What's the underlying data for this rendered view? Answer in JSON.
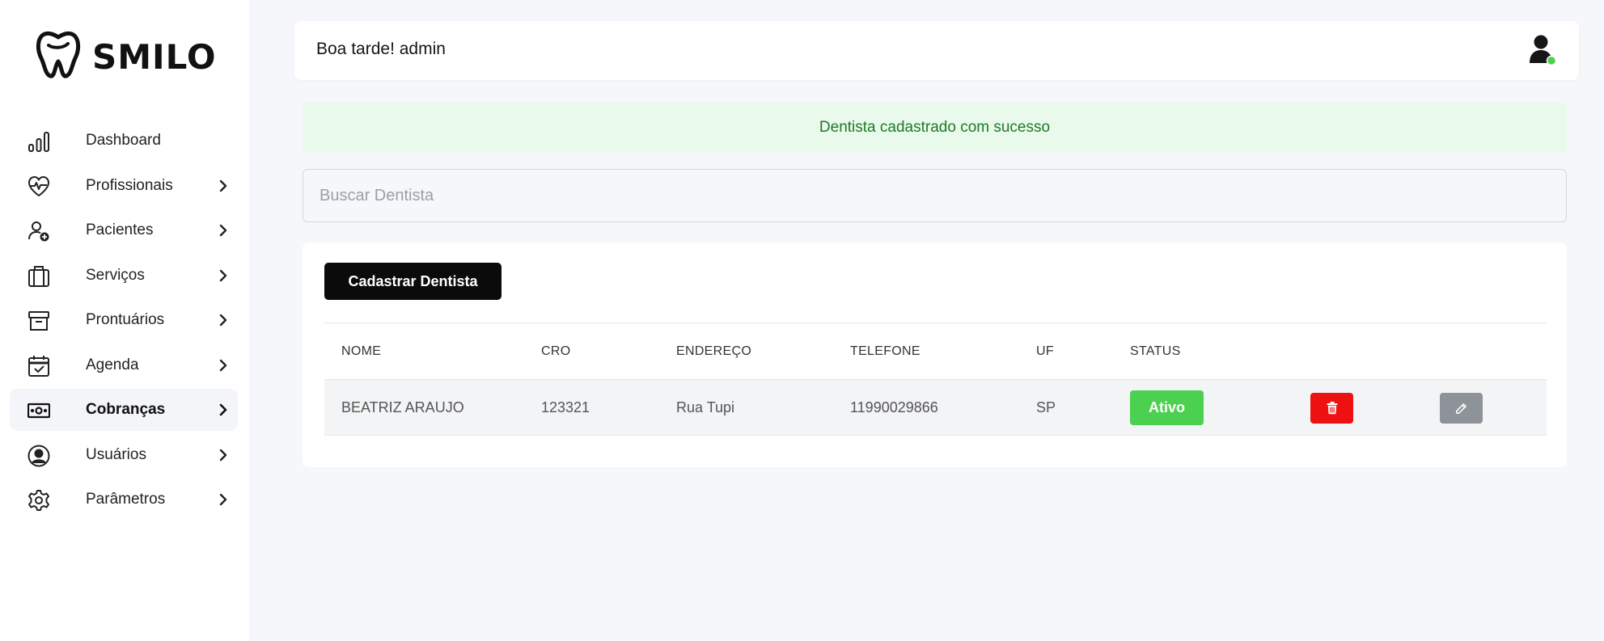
{
  "brand": {
    "name": "SMILO",
    "logo_icon": "tooth-icon"
  },
  "sidebar": {
    "items": [
      {
        "label": "Dashboard",
        "icon": "bar-chart-icon",
        "has_submenu": false
      },
      {
        "label": "Profissionais",
        "icon": "heart-pulse-icon",
        "has_submenu": true
      },
      {
        "label": "Pacientes",
        "icon": "user-plus-icon",
        "has_submenu": true
      },
      {
        "label": "Serviços",
        "icon": "briefcase-icon",
        "has_submenu": true
      },
      {
        "label": "Prontuários",
        "icon": "archive-icon",
        "has_submenu": true
      },
      {
        "label": "Agenda",
        "icon": "calendar-check-icon",
        "has_submenu": true
      },
      {
        "label": "Cobranças",
        "icon": "money-icon",
        "has_submenu": true,
        "active": true
      },
      {
        "label": "Usuários",
        "icon": "user-circle-icon",
        "has_submenu": true
      },
      {
        "label": "Parâmetros",
        "icon": "gear-icon",
        "has_submenu": true
      }
    ]
  },
  "header": {
    "greeting": "Boa tarde! admin",
    "avatar_icon": "user-icon",
    "status_color": "#4cd04f"
  },
  "alert": {
    "message": "Dentista cadastrado com sucesso",
    "color": "#1e7a26",
    "background": "#e9f9ec"
  },
  "search": {
    "placeholder": "Buscar Dentista",
    "value": ""
  },
  "actions": {
    "add_label": "Cadastrar Dentista"
  },
  "table": {
    "columns": [
      "NOME",
      "CRO",
      "ENDEREÇO",
      "TELEFONE",
      "UF",
      "STATUS"
    ],
    "rows": [
      {
        "nome": "BEATRIZ ARAUJO",
        "cro": "123321",
        "endereco": "Rua Tupi",
        "telefone": "11990029866",
        "uf": "SP",
        "status": "Ativo"
      }
    ]
  },
  "colors": {
    "status_active": "#4cd04f",
    "delete": "#ee1111",
    "edit": "#8e9399",
    "primary_button": "#0b0b0c"
  }
}
